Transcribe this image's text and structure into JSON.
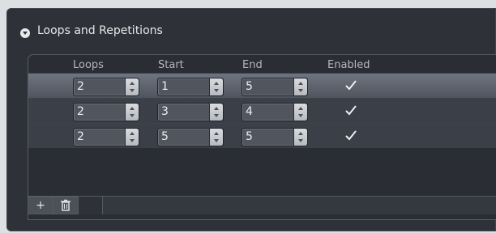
{
  "panel": {
    "title": "Loops and Repetitions",
    "collapse_icon": "chevron-down-icon"
  },
  "table": {
    "headers": [
      "Loops",
      "Start",
      "End",
      "Enabled"
    ],
    "rows": [
      {
        "loops": "2",
        "start": "1",
        "end": "5",
        "enabled": true
      },
      {
        "loops": "2",
        "start": "3",
        "end": "4",
        "enabled": true
      },
      {
        "loops": "2",
        "start": "5",
        "end": "5",
        "enabled": true
      }
    ]
  },
  "footer": {
    "add_label": "+",
    "delete_icon": "trash-icon"
  },
  "colors": {
    "panel_bg": "#2e3138",
    "selected_row": "#6f7580",
    "row_bg": "#3b3f47",
    "text": "#e8e8e9"
  }
}
